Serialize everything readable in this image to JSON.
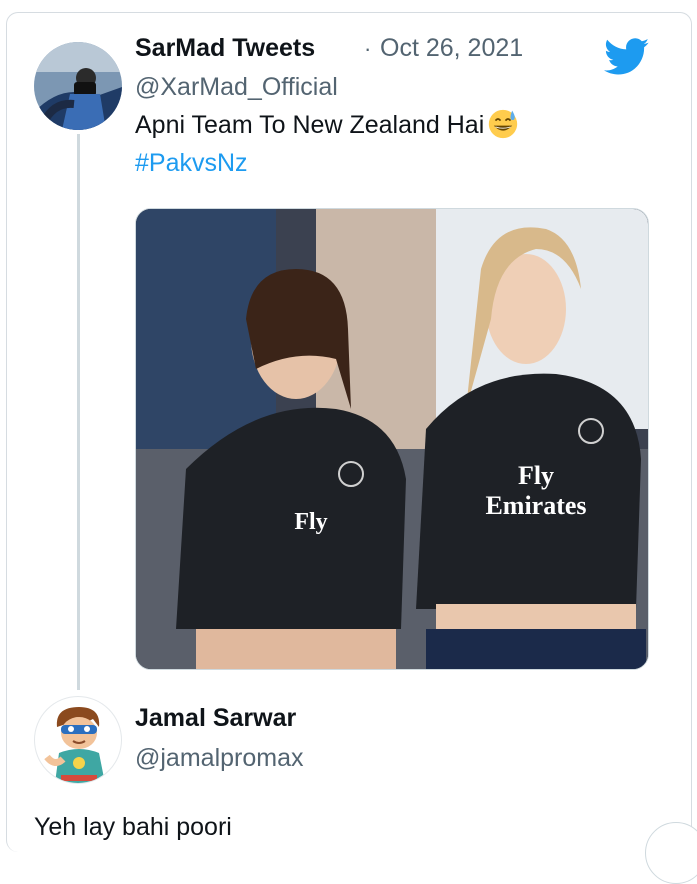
{
  "tweet": {
    "author_name": "SarMad Tweets",
    "separator": "·",
    "date": "Oct 26, 2021",
    "handle": "@XarMad_Official",
    "text": "Apni Team To New Zealand Hai",
    "emoji": "grinning-face-with-sweat-icon",
    "hashtag": "#PakvsNz",
    "media_caption": "Fly Emirates"
  },
  "reply": {
    "author_name": "Jamal Sarwar",
    "handle": "@jamalpromax",
    "text": "Yeh lay bahi poori"
  },
  "colors": {
    "twitter_blue": "#1d9bf0",
    "secondary_text": "#536471",
    "thread_line": "#cfd9de"
  },
  "icons": [
    "twitter-bird-icon",
    "grinning-face-with-sweat-icon"
  ]
}
